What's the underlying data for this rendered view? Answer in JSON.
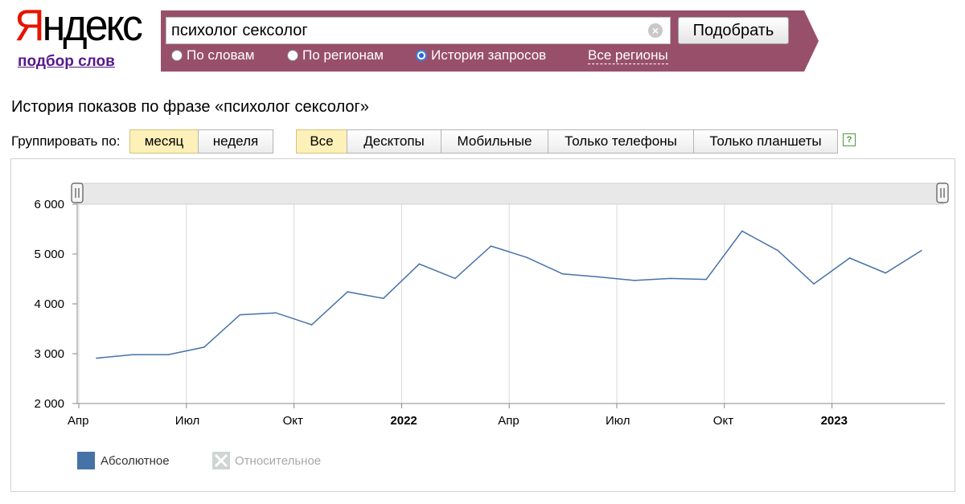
{
  "logo": {
    "first": "Я",
    "rest": "ндекс"
  },
  "sublink": "подбор слов",
  "search": {
    "query": "психолог сексолог",
    "submit_label": "Подобрать",
    "modes": [
      {
        "label": "По словам",
        "selected": false
      },
      {
        "label": "По регионам",
        "selected": false
      },
      {
        "label": "История запросов",
        "selected": true
      }
    ],
    "regions_link": "Все регионы"
  },
  "heading": "История показов по фразе «психолог сексолог»",
  "grouping": {
    "label": "Группировать по:",
    "options": [
      {
        "label": "месяц",
        "active": true
      },
      {
        "label": "неделя",
        "active": false
      }
    ]
  },
  "devices": [
    {
      "label": "Все",
      "active": true
    },
    {
      "label": "Десктопы",
      "active": false
    },
    {
      "label": "Мобильные",
      "active": false
    },
    {
      "label": "Только телефоны",
      "active": false
    },
    {
      "label": "Только планшеты",
      "active": false
    }
  ],
  "help_icon": "?",
  "colors": {
    "series": "#4572a7",
    "panel": "#98506a",
    "active_button": "#fdf0b8"
  },
  "chart_data": {
    "type": "line",
    "title": "",
    "xlabel": "",
    "ylabel": "",
    "ylim": [
      2000,
      6000
    ],
    "yticks": [
      {
        "value": 2000,
        "label": "2 000"
      },
      {
        "value": 3000,
        "label": "3 000"
      },
      {
        "value": 4000,
        "label": "4 000"
      },
      {
        "value": 5000,
        "label": "5 000"
      },
      {
        "value": 6000,
        "label": "6 000"
      }
    ],
    "xticks": [
      {
        "x": "2021-04",
        "label": "Апр",
        "bold": false
      },
      {
        "x": "2021-07",
        "label": "Июл",
        "bold": false
      },
      {
        "x": "2021-10",
        "label": "Окт",
        "bold": false
      },
      {
        "x": "2022-01",
        "label": "2022",
        "bold": true
      },
      {
        "x": "2022-04",
        "label": "Апр",
        "bold": false
      },
      {
        "x": "2022-07",
        "label": "Июл",
        "bold": false
      },
      {
        "x": "2022-10",
        "label": "Окт",
        "bold": false
      },
      {
        "x": "2023-01",
        "label": "2023",
        "bold": true
      }
    ],
    "grid": true,
    "legend_position": "bottom-left",
    "series": [
      {
        "name": "Абсолютное",
        "active": true,
        "points": [
          {
            "x": "2021-04",
            "y": 2910
          },
          {
            "x": "2021-05",
            "y": 2980
          },
          {
            "x": "2021-06",
            "y": 2980
          },
          {
            "x": "2021-07",
            "y": 3130
          },
          {
            "x": "2021-08",
            "y": 3780
          },
          {
            "x": "2021-09",
            "y": 3820
          },
          {
            "x": "2021-10",
            "y": 3580
          },
          {
            "x": "2021-11",
            "y": 4240
          },
          {
            "x": "2021-12",
            "y": 4110
          },
          {
            "x": "2022-01",
            "y": 4800
          },
          {
            "x": "2022-02",
            "y": 4510
          },
          {
            "x": "2022-03",
            "y": 5160
          },
          {
            "x": "2022-04",
            "y": 4930
          },
          {
            "x": "2022-05",
            "y": 4600
          },
          {
            "x": "2022-06",
            "y": 4540
          },
          {
            "x": "2022-07",
            "y": 4470
          },
          {
            "x": "2022-08",
            "y": 4510
          },
          {
            "x": "2022-09",
            "y": 4490
          },
          {
            "x": "2022-10",
            "y": 5460
          },
          {
            "x": "2022-11",
            "y": 5070
          },
          {
            "x": "2022-12",
            "y": 4400
          },
          {
            "x": "2023-01",
            "y": 4920
          },
          {
            "x": "2023-02",
            "y": 4620
          },
          {
            "x": "2023-03",
            "y": 5070
          }
        ]
      },
      {
        "name": "Относительное",
        "active": false,
        "points": []
      }
    ]
  }
}
